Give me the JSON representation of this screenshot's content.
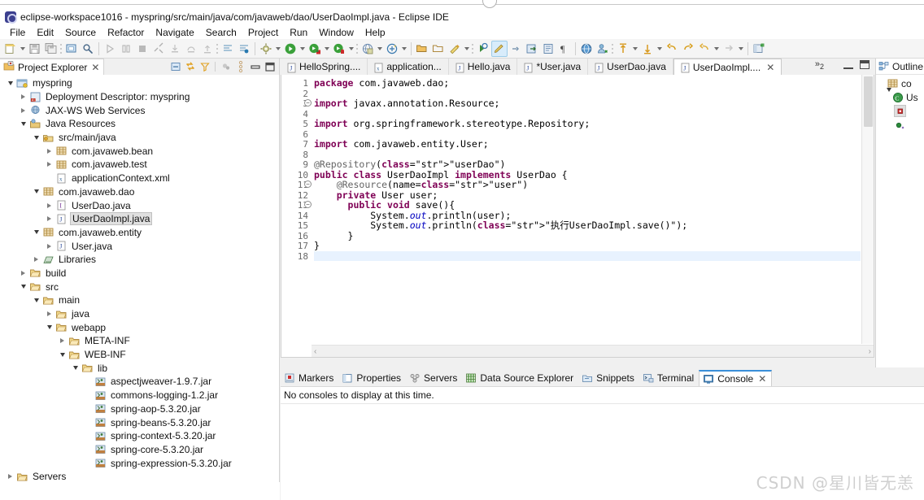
{
  "window": {
    "title": "eclipse-workspace1016 - myspring/src/main/java/com/javaweb/dao/UserDaoImpl.java - Eclipse IDE",
    "icon": "eclipse-icon"
  },
  "menubar": {
    "items": [
      "File",
      "Edit",
      "Source",
      "Refactor",
      "Navigate",
      "Search",
      "Project",
      "Run",
      "Window",
      "Help"
    ]
  },
  "toolbar": {
    "groups": [
      {
        "items": [
          {
            "name": "new-wizard-icon",
            "dropdown": true
          },
          {
            "name": "save-icon",
            "dropdown": false
          },
          {
            "name": "save-all-icon",
            "dropdown": false
          }
        ]
      },
      {
        "items": [
          {
            "name": "print-icon",
            "dropdown": false
          },
          {
            "name": "search-icon",
            "dropdown": false
          }
        ]
      },
      {
        "items": [
          {
            "name": "resume-icon",
            "dropdown": false
          },
          {
            "name": "suspend-icon",
            "dropdown": false
          },
          {
            "name": "terminate-icon",
            "dropdown": false
          },
          {
            "name": "disconnect-icon",
            "dropdown": false
          },
          {
            "name": "step-into-icon",
            "dropdown": false
          },
          {
            "name": "step-over-icon",
            "dropdown": false
          },
          {
            "name": "step-return-icon",
            "dropdown": false
          }
        ]
      },
      {
        "items": [
          {
            "name": "skip-breakpoints-icon",
            "dropdown": false
          },
          {
            "name": "toggle-breakpoint-icon",
            "dropdown": false
          }
        ]
      },
      {
        "items": [
          {
            "name": "build-icon",
            "dropdown": true
          },
          {
            "name": "run-icon",
            "dropdown": true
          },
          {
            "name": "debug-icon",
            "dropdown": true
          },
          {
            "name": "coverage-icon",
            "dropdown": true
          }
        ]
      },
      {
        "items": [
          {
            "name": "run-on-server-icon",
            "dropdown": true
          },
          {
            "name": "new-server-icon",
            "dropdown": true
          }
        ]
      },
      {
        "items": [
          {
            "name": "open-type-icon",
            "dropdown": false
          },
          {
            "name": "open-task-icon",
            "dropdown": false
          },
          {
            "name": "new-java-package-icon",
            "dropdown": true
          }
        ]
      },
      {
        "items": [
          {
            "name": "new-java-class-icon",
            "dropdown": false
          },
          {
            "name": "highlight-icon",
            "dropdown": false,
            "selected": true
          },
          {
            "name": "link-icon",
            "dropdown": false
          },
          {
            "name": "external-tools-icon",
            "dropdown": false
          },
          {
            "name": "book-icon",
            "dropdown": false
          },
          {
            "name": "paragraph-icon",
            "dropdown": false
          }
        ]
      },
      {
        "items": [
          {
            "name": "web-browser-icon",
            "dropdown": false
          },
          {
            "name": "profile-icon",
            "dropdown": false
          }
        ]
      },
      {
        "items": [
          {
            "name": "previous-annotation-icon",
            "dropdown": true
          },
          {
            "name": "next-annotation-icon",
            "dropdown": true
          },
          {
            "name": "back-icon",
            "dropdown": false
          },
          {
            "name": "forward-icon",
            "dropdown": false
          },
          {
            "name": "prev-edit-icon",
            "dropdown": true
          },
          {
            "name": "next-edit-icon",
            "dropdown": true
          }
        ]
      },
      {
        "items": [
          {
            "name": "open-perspective-icon",
            "dropdown": false
          }
        ]
      }
    ]
  },
  "project_explorer": {
    "tab_label": "Project Explorer",
    "tab_icon": "project-explorer-icon",
    "close_label": "✕",
    "tools": [
      {
        "name": "collapse-all-icon",
        "label": "⊟"
      },
      {
        "name": "link-with-editor-icon",
        "label": "⇄"
      },
      {
        "name": "view-filter-icon",
        "label": "∇"
      },
      {
        "name": "focus-on-active-task-icon",
        "label": "●"
      },
      {
        "name": "view-menu-icon",
        "label": "⋮"
      },
      {
        "name": "minimize-view-icon",
        "label": "—"
      },
      {
        "name": "maximize-view-icon",
        "label": "❑"
      }
    ],
    "tree": [
      {
        "label": "myspring",
        "depth": 0,
        "state": "expanded",
        "icon": "project-icon"
      },
      {
        "label": "Deployment Descriptor: myspring",
        "depth": 1,
        "state": "collapsed",
        "icon": "deployment-descriptor-icon"
      },
      {
        "label": "JAX-WS Web Services",
        "depth": 1,
        "state": "collapsed",
        "icon": "web-service-icon"
      },
      {
        "label": "Java Resources",
        "depth": 1,
        "state": "expanded",
        "icon": "java-resources-icon"
      },
      {
        "label": "src/main/java",
        "depth": 2,
        "state": "expanded",
        "icon": "source-folder-icon"
      },
      {
        "label": "com.javaweb.bean",
        "depth": 3,
        "state": "collapsed",
        "icon": "package-icon"
      },
      {
        "label": "com.javaweb.test",
        "depth": 3,
        "state": "collapsed",
        "icon": "package-icon"
      },
      {
        "label": "applicationContext.xml",
        "depth": 3,
        "state": "leaf",
        "icon": "xml-file-icon"
      },
      {
        "label": "com.javaweb.dao",
        "depth": 2,
        "state": "expanded",
        "icon": "package-icon"
      },
      {
        "label": "UserDao.java",
        "depth": 3,
        "state": "collapsed",
        "icon": "java-interface-icon"
      },
      {
        "label": "UserDaoImpl.java",
        "depth": 3,
        "state": "collapsed",
        "icon": "java-file-icon",
        "selected": true
      },
      {
        "label": "com.javaweb.entity",
        "depth": 2,
        "state": "expanded",
        "icon": "package-icon"
      },
      {
        "label": "User.java",
        "depth": 3,
        "state": "collapsed",
        "icon": "java-file-icon"
      },
      {
        "label": "Libraries",
        "depth": 2,
        "state": "collapsed",
        "icon": "libraries-icon"
      },
      {
        "label": "build",
        "depth": 1,
        "state": "collapsed",
        "icon": "folder-icon"
      },
      {
        "label": "src",
        "depth": 1,
        "state": "expanded",
        "icon": "folder-icon"
      },
      {
        "label": "main",
        "depth": 2,
        "state": "expanded",
        "icon": "folder-icon"
      },
      {
        "label": "java",
        "depth": 3,
        "state": "collapsed",
        "icon": "folder-icon"
      },
      {
        "label": "webapp",
        "depth": 3,
        "state": "expanded",
        "icon": "folder-icon"
      },
      {
        "label": "META-INF",
        "depth": 4,
        "state": "collapsed",
        "icon": "folder-icon"
      },
      {
        "label": "WEB-INF",
        "depth": 4,
        "state": "expanded",
        "icon": "folder-icon"
      },
      {
        "label": "lib",
        "depth": 5,
        "state": "expanded",
        "icon": "folder-icon"
      },
      {
        "label": "aspectjweaver-1.9.7.jar",
        "depth": 6,
        "state": "leaf",
        "icon": "jar-icon"
      },
      {
        "label": "commons-logging-1.2.jar",
        "depth": 6,
        "state": "leaf",
        "icon": "jar-icon"
      },
      {
        "label": "spring-aop-5.3.20.jar",
        "depth": 6,
        "state": "leaf",
        "icon": "jar-icon"
      },
      {
        "label": "spring-beans-5.3.20.jar",
        "depth": 6,
        "state": "leaf",
        "icon": "jar-icon"
      },
      {
        "label": "spring-context-5.3.20.jar",
        "depth": 6,
        "state": "leaf",
        "icon": "jar-icon"
      },
      {
        "label": "spring-core-5.3.20.jar",
        "depth": 6,
        "state": "leaf",
        "icon": "jar-icon"
      },
      {
        "label": "spring-expression-5.3.20.jar",
        "depth": 6,
        "state": "leaf",
        "icon": "jar-icon"
      },
      {
        "label": "Servers",
        "depth": 0,
        "state": "collapsed",
        "icon": "folder-icon"
      }
    ]
  },
  "editor": {
    "tabs": [
      {
        "label": "HelloSpring....",
        "icon": "java-file-icon",
        "active": false,
        "closable": false
      },
      {
        "label": "application...",
        "icon": "xml-file-icon",
        "active": false,
        "closable": false
      },
      {
        "label": "Hello.java",
        "icon": "java-file-icon",
        "active": false,
        "closable": false
      },
      {
        "label": "*User.java",
        "icon": "java-file-icon",
        "active": false,
        "closable": false
      },
      {
        "label": "UserDao.java",
        "icon": "java-file-icon",
        "active": false,
        "closable": false
      },
      {
        "label": "UserDaoImpl....",
        "icon": "java-file-icon",
        "active": true,
        "closable": true
      }
    ],
    "overflow_label": "»",
    "overflow_count": "2",
    "close_label": "✕",
    "minimize_label": "minimize-editor-icon",
    "maximize_label": "maximize-editor-icon",
    "filename": "UserDaoImpl.java",
    "lines": [
      {
        "num": "1",
        "text": "package com.javaweb.dao;",
        "fold": false
      },
      {
        "num": "2",
        "text": "",
        "fold": false
      },
      {
        "num": "3",
        "text": "import javax.annotation.Resource;",
        "fold": true
      },
      {
        "num": "4",
        "text": "",
        "fold": false
      },
      {
        "num": "5",
        "text": "import org.springframework.stereotype.Repository;",
        "fold": false
      },
      {
        "num": "6",
        "text": "",
        "fold": false
      },
      {
        "num": "7",
        "text": "import com.javaweb.entity.User;",
        "fold": false
      },
      {
        "num": "8",
        "text": "",
        "fold": false
      },
      {
        "num": "9",
        "text": "@Repository(\"userDao\")",
        "fold": false
      },
      {
        "num": "10",
        "text": "public class UserDaoImpl implements UserDao {",
        "fold": false
      },
      {
        "num": "11",
        "text": "    @Resource(name=\"user\")",
        "fold": true
      },
      {
        "num": "12",
        "text": "    private User user;",
        "fold": false
      },
      {
        "num": "13",
        "text": "      public void save(){",
        "fold": true
      },
      {
        "num": "14",
        "text": "          System.out.println(user);",
        "fold": false
      },
      {
        "num": "15",
        "text": "          System.out.println(\"执行UserDaoImpl.save()\");",
        "fold": false
      },
      {
        "num": "16",
        "text": "      }",
        "fold": false
      },
      {
        "num": "17",
        "text": "}",
        "fold": false
      },
      {
        "num": "18",
        "text": "",
        "fold": false
      }
    ],
    "scroll_left_label": "‹",
    "scroll_right_label": "›"
  },
  "outline": {
    "tab_label": "Outline",
    "tab_icon": "outline-icon",
    "rows": [
      {
        "label": "co",
        "icon": "package-icon",
        "depth": 1,
        "state": "leaf"
      },
      {
        "label": "Us",
        "icon": "class-icon",
        "depth": 1,
        "state": "expanded"
      },
      {
        "label": "",
        "icon": "field-icon",
        "depth": 2,
        "state": "leaf",
        "selected": true
      },
      {
        "label": "",
        "icon": "method-icon",
        "depth": 2,
        "state": "leaf"
      }
    ]
  },
  "bottom_panel": {
    "tabs": [
      {
        "label": "Markers",
        "icon": "markers-icon",
        "active": false,
        "closable": false
      },
      {
        "label": "Properties",
        "icon": "properties-icon",
        "active": false,
        "closable": false
      },
      {
        "label": "Servers",
        "icon": "servers-icon",
        "active": false,
        "closable": false
      },
      {
        "label": "Data Source Explorer",
        "icon": "data-source-icon",
        "active": false,
        "closable": false
      },
      {
        "label": "Snippets",
        "icon": "snippets-icon",
        "active": false,
        "closable": false
      },
      {
        "label": "Terminal",
        "icon": "terminal-icon",
        "active": false,
        "closable": false
      },
      {
        "label": "Console",
        "icon": "console-icon",
        "active": true,
        "closable": true
      }
    ],
    "close_label": "✕",
    "message": "No consoles to display at this time."
  },
  "watermark": {
    "text": "CSDN @星川皆无恙"
  },
  "colors": {
    "accent": "#3a8fd9",
    "keyword": "#7f0055",
    "string": "#2a00ff",
    "annotation": "#646464",
    "selection": "#e0e0e0",
    "cursor_line": "#e8f2fe"
  }
}
